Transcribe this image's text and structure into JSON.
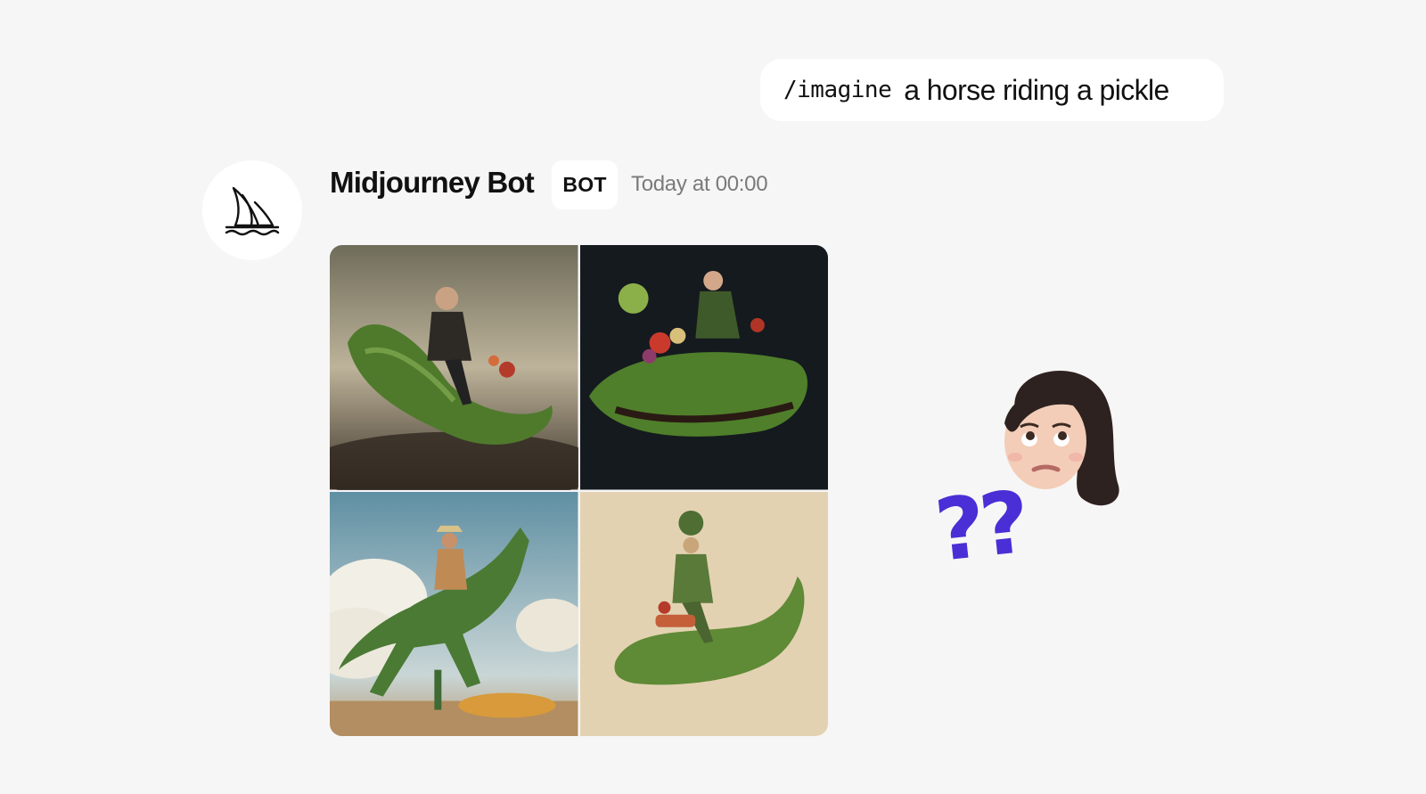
{
  "prompt": {
    "command": "/imagine",
    "text": "a horse riding a pickle"
  },
  "message": {
    "author": "Midjourney Bot",
    "badge": "BOT",
    "timestamp": "Today at 00:00",
    "avatar_icon": "sailboat-icon",
    "images": [
      {
        "name": "image-tile-1"
      },
      {
        "name": "image-tile-2"
      },
      {
        "name": "image-tile-3"
      },
      {
        "name": "image-tile-4"
      }
    ]
  },
  "reaction": {
    "emoji": "memoji-confused-face",
    "symbol": "??",
    "symbol_color": "#4a2ed6"
  }
}
